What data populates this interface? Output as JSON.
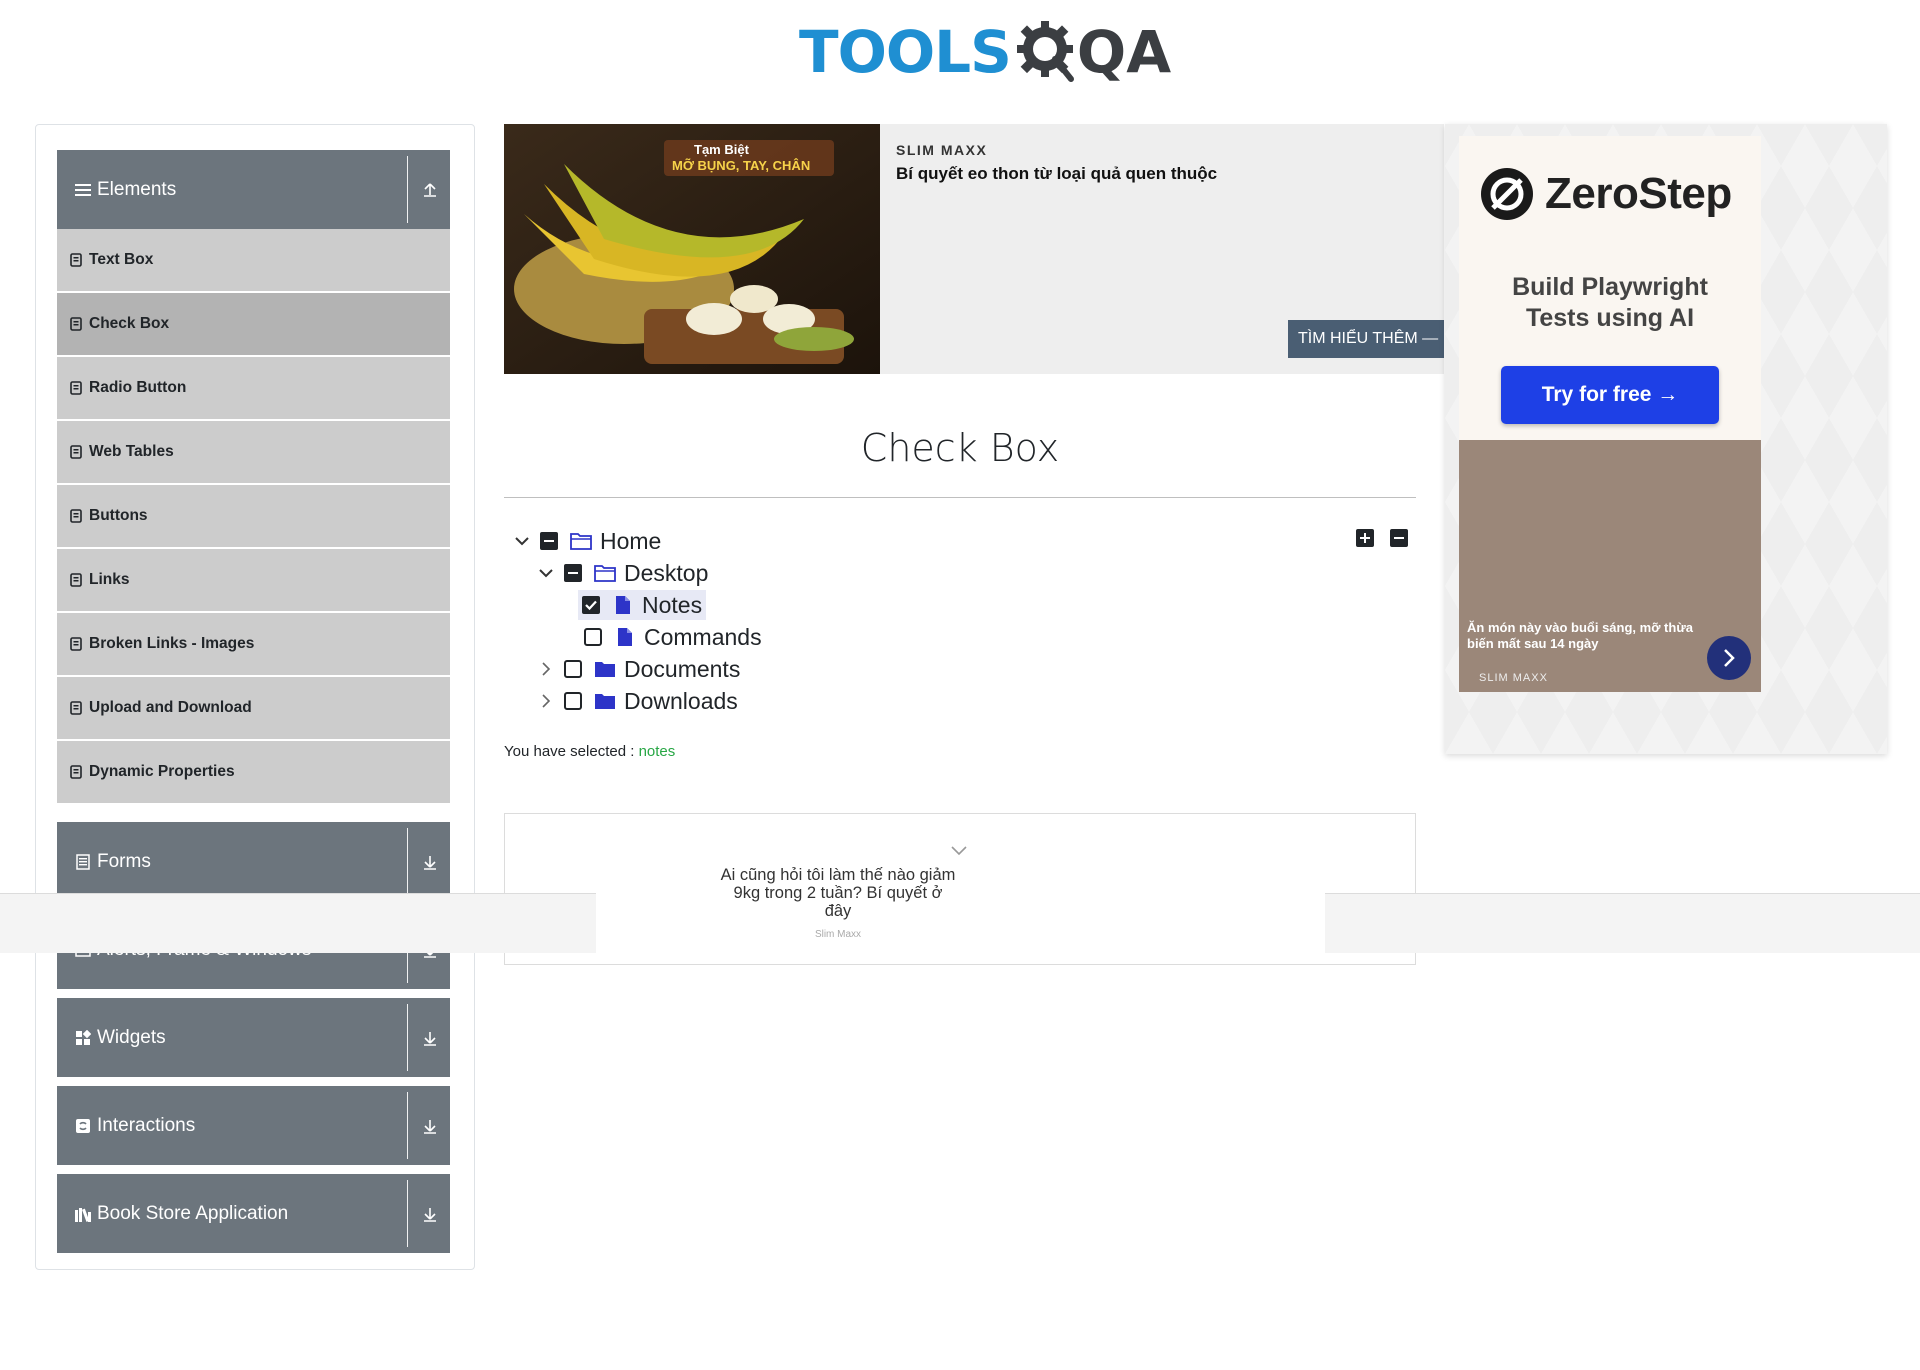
{
  "logo": {
    "tools": "TOOLS",
    "qa": "QA"
  },
  "sidebar": {
    "elements": {
      "label": "Elements",
      "icon": "hamburger-icon",
      "toggle_icon": "collapse-up-icon"
    },
    "element_items": [
      {
        "label": "Text Box",
        "active": false
      },
      {
        "label": "Check Box",
        "active": true
      },
      {
        "label": "Radio Button",
        "active": false
      },
      {
        "label": "Web Tables",
        "active": false
      },
      {
        "label": "Buttons",
        "active": false
      },
      {
        "label": "Links",
        "active": false
      },
      {
        "label": "Broken Links - Images",
        "active": false
      },
      {
        "label": "Upload and Download",
        "active": false
      },
      {
        "label": "Dynamic Properties",
        "active": false
      }
    ],
    "forms": {
      "label": "Forms",
      "icon": "form-icon"
    },
    "alerts": {
      "label": "Alerts, Frame & Windows",
      "icon": "window-icon"
    },
    "widgets": {
      "label": "Widgets",
      "icon": "widgets-icon"
    },
    "interactions": {
      "label": "Interactions",
      "icon": "interactions-icon"
    },
    "bookstore": {
      "label": "Book Store Application",
      "icon": "books-icon"
    }
  },
  "ad_banner": {
    "image_text_1": "Tạm Biệt",
    "image_text_2": "MỠ BỤNG, TAY, CHÂN",
    "brand": "SLIM MAXX",
    "title": "Bí quyết eo thon từ loại quả quen thuộc",
    "cta": "TÌM HIỂU THÊM —"
  },
  "right_ad": {
    "brand": "ZeroStep",
    "tagline_1": "Build Playwright",
    "tagline_2": "Tests using AI",
    "button": "Try for free →",
    "photo_text": "Ăn món này vào buổi sáng, mỡ thừa biến mất sau 14 ngày",
    "photo_brand": "SLIM MAXX"
  },
  "main": {
    "title": "Check Box",
    "tree": {
      "home": "Home",
      "desktop": "Desktop",
      "notes": "Notes",
      "commands": "Commands",
      "documents": "Documents",
      "downloads": "Downloads"
    },
    "selected_label": "You have selected :",
    "selected_value": "notes"
  },
  "sticky_ad": {
    "text": "Ai cũng hỏi tôi làm thế nào giảm 9kg trong 2 tuần? Bí quyết ở đây",
    "brand": "Slim Maxx"
  },
  "colors": {
    "sidebar_header": "#6c757d",
    "sidebar_item": "#cccccc",
    "sidebar_item_active": "#b3b3b3",
    "logo_tools": "#1f8fd2",
    "logo_qa": "#3b3e42",
    "folder_icon": "#2d34c8",
    "selected_value": "#28a745",
    "zerostep_button": "#1e40e6"
  }
}
